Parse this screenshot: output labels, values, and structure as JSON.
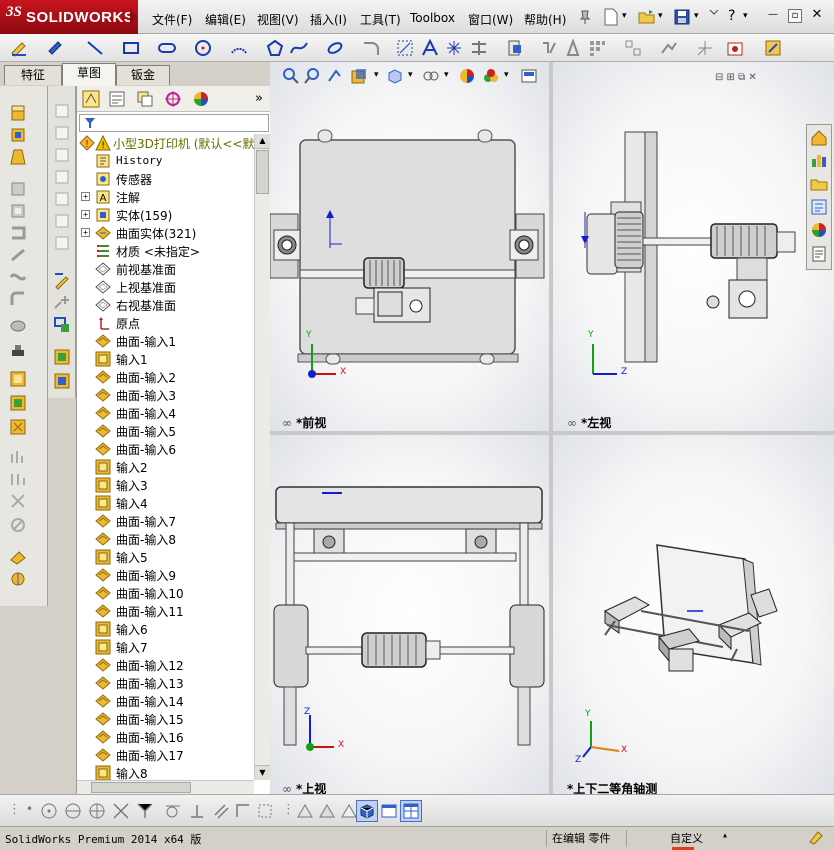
{
  "app": {
    "logo_brand": "SOLIDWORKS",
    "logo_ds": "3S"
  },
  "menu": {
    "items": [
      "文件(F)",
      "编辑(E)",
      "视图(V)",
      "插入(I)",
      "工具(T)",
      "Toolbox",
      "窗口(W)",
      "帮助(H)"
    ]
  },
  "tabs": [
    "特征",
    "草图",
    "钣金"
  ],
  "tree": {
    "root": "小型3D打印机  (默认<<默认",
    "items": [
      {
        "label": "History",
        "icon": "history-icon",
        "expand": false,
        "mono": true
      },
      {
        "label": "传感器",
        "icon": "sensor-icon",
        "expand": false
      },
      {
        "label": "注解",
        "icon": "annotation-icon",
        "expand": true
      },
      {
        "label": "实体(159)",
        "icon": "solid-bodies-icon",
        "expand": true
      },
      {
        "label": "曲面实体(321)",
        "icon": "surface-bodies-icon",
        "expand": true
      },
      {
        "label": "材质 <未指定>",
        "icon": "material-icon",
        "expand": false
      },
      {
        "label": "前视基准面",
        "icon": "plane-icon",
        "expand": false
      },
      {
        "label": "上视基准面",
        "icon": "plane-icon",
        "expand": false
      },
      {
        "label": "右视基准面",
        "icon": "plane-icon",
        "expand": false
      },
      {
        "label": "原点",
        "icon": "origin-icon",
        "expand": false
      },
      {
        "label": "曲面-输入1",
        "icon": "surface-import-icon"
      },
      {
        "label": "输入1",
        "icon": "import-icon"
      },
      {
        "label": "曲面-输入2",
        "icon": "surface-import-icon"
      },
      {
        "label": "曲面-输入3",
        "icon": "surface-import-icon"
      },
      {
        "label": "曲面-输入4",
        "icon": "surface-import-icon"
      },
      {
        "label": "曲面-输入5",
        "icon": "surface-import-icon"
      },
      {
        "label": "曲面-输入6",
        "icon": "surface-import-icon"
      },
      {
        "label": "输入2",
        "icon": "import-icon"
      },
      {
        "label": "输入3",
        "icon": "import-icon"
      },
      {
        "label": "输入4",
        "icon": "import-icon"
      },
      {
        "label": "曲面-输入7",
        "icon": "surface-import-icon"
      },
      {
        "label": "曲面-输入8",
        "icon": "surface-import-icon"
      },
      {
        "label": "输入5",
        "icon": "import-icon"
      },
      {
        "label": "曲面-输入9",
        "icon": "surface-import-icon"
      },
      {
        "label": "曲面-输入10",
        "icon": "surface-import-icon"
      },
      {
        "label": "曲面-输入11",
        "icon": "surface-import-icon"
      },
      {
        "label": "输入6",
        "icon": "import-icon"
      },
      {
        "label": "输入7",
        "icon": "import-icon"
      },
      {
        "label": "曲面-输入12",
        "icon": "surface-import-icon"
      },
      {
        "label": "曲面-输入13",
        "icon": "surface-import-icon"
      },
      {
        "label": "曲面-输入14",
        "icon": "surface-import-icon"
      },
      {
        "label": "曲面-输入15",
        "icon": "surface-import-icon"
      },
      {
        "label": "曲面-输入16",
        "icon": "surface-import-icon"
      },
      {
        "label": "曲面-输入17",
        "icon": "surface-import-icon"
      },
      {
        "label": "输入8",
        "icon": "import-icon"
      }
    ]
  },
  "views": {
    "front": "*前视",
    "left": "*左视",
    "top": "*上视",
    "iso": "*上下二等角轴测"
  },
  "axes": {
    "x": "X",
    "y": "Y",
    "z": "Z"
  },
  "status": {
    "product": "SolidWorks Premium 2014 x64 版",
    "mode": "在编辑 零件",
    "units": "自定义"
  },
  "colors": {
    "brand": "#c8141e",
    "axis_x": "#d01010",
    "axis_y": "#10a010",
    "axis_z": "#1020d0",
    "part_grey": "#d8d8d8"
  }
}
